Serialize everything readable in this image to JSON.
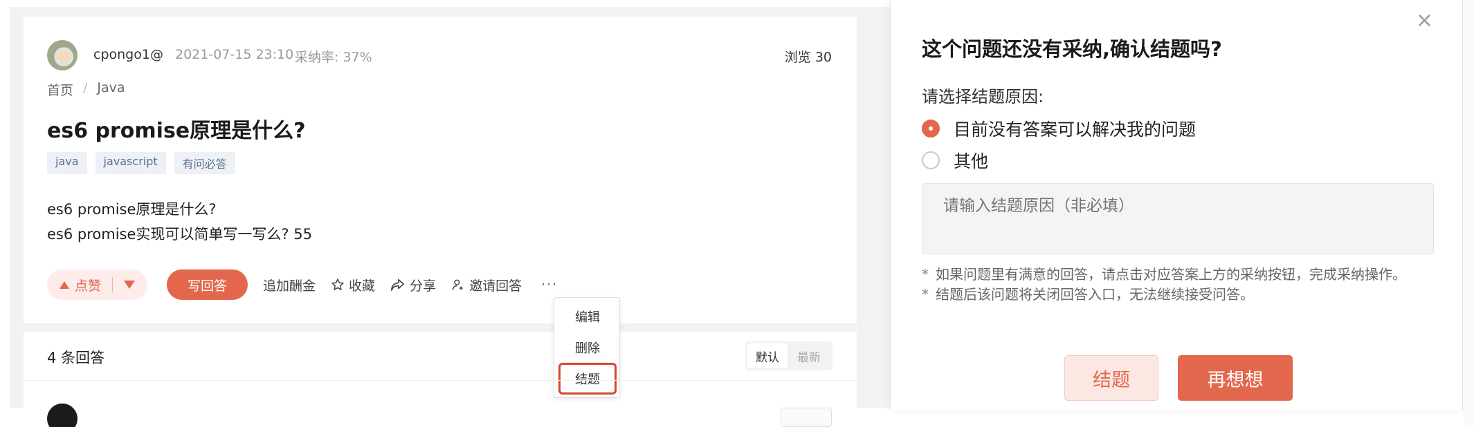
{
  "question": {
    "author": "cpongo1@",
    "date": "2021-07-15 23:10",
    "accept_rate": "采纳率: 37%",
    "views": "浏览 30",
    "breadcrumb": [
      "首页",
      "/",
      "Java"
    ],
    "title": "es6 promise原理是什么?",
    "tags": [
      "java",
      "javascript",
      "有问必答"
    ],
    "body_lines": [
      "es6 promise原理是什么?",
      "es6 promise实现可以简单写一写么? 55"
    ]
  },
  "actions": {
    "like": "点赞",
    "write_answer": "写回答",
    "add_bounty": "追加酬金",
    "collect": "收藏",
    "share": "分享",
    "invite": "邀请回答",
    "more": "···"
  },
  "dropdown": {
    "items": [
      "编辑",
      "删除",
      "结题"
    ]
  },
  "answers": {
    "count_label": "4 条回答",
    "sort_default": "默认",
    "sort_latest": "最新"
  },
  "dialog": {
    "close": "×",
    "title": "这个问题还没有采纳,确认结题吗?",
    "reason_label": "请选择结题原因:",
    "options": [
      "目前没有答案可以解决我的问题",
      "其他"
    ],
    "textarea_placeholder": "请输入结题原因（非必填）",
    "notes": [
      "如果问题里有满意的回答，请点击对应答案上方的采纳按钮，完成采纳操作。",
      "结题后该问题将关闭回答入口，无法继续接受问答。"
    ],
    "note_marker": "*",
    "btn_close": "结题",
    "btn_rethink": "再想想"
  },
  "colors": {
    "accent": "#e3674c",
    "highlight_border": "#d9442b"
  }
}
